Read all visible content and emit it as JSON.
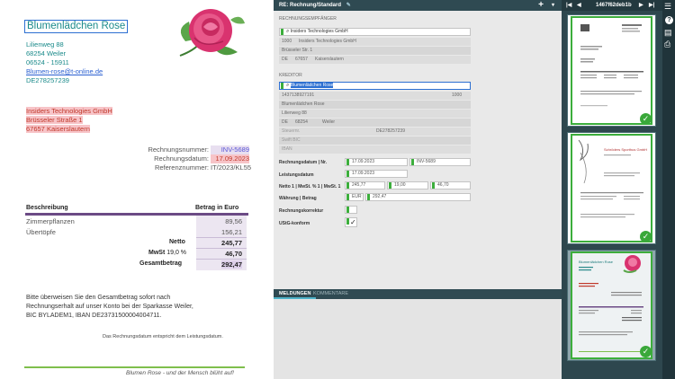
{
  "invoice": {
    "sender_name": "Blumenlädchen Rose",
    "sender_lines": [
      "Lilienweg 88",
      "68254 Weiler",
      "06524 - 15911"
    ],
    "sender_email": "Blumen-rose@t-online.de",
    "sender_vat": "DE278257239",
    "recipient_lines": [
      "Insiders Technologies GmbH",
      "Brüsseler Straße 1",
      "67657 Kaiserslautern"
    ],
    "meta": [
      {
        "label": "Rechnungsnummer:",
        "value": "INV-5689"
      },
      {
        "label": "Rechnungsdatum:",
        "value": "17.09.2023"
      },
      {
        "label": "Referenznummer:",
        "value": "IT/2023/KL55"
      }
    ],
    "table_head": {
      "desc": "Beschreibung",
      "amount": "Betrag in Euro"
    },
    "items": [
      {
        "desc": "Zimmerpflanzen",
        "amount": "89,56"
      },
      {
        "desc": "Übertöpfe",
        "amount": "156,21"
      }
    ],
    "netto_label": "Netto",
    "netto": "245,77",
    "mwst_label": "MwSt",
    "mwst_rate": "19,0 %",
    "mwst": "46,70",
    "total_label": "Gesamtbetrag",
    "total": "292,47",
    "payment_text": [
      "Bitte überweisen Sie den Gesamtbetrag sofort nach",
      "Rechnungserhalt auf unser Konto bei der Sparkasse Weiler,",
      "BIC BYLADEM1, IBAN DE23731500004004711."
    ],
    "note": "Das Rechnungsdatum entspricht dem Leistungsdatum.",
    "footer": "Blumen Rose - und der Mensch blüht auf!"
  },
  "center": {
    "title": "RE: Rechnung/Standard",
    "plus": "+",
    "sections": {
      "recipient": "RECHNUNGSEMPFÄNGER",
      "creditor": "KREDITOR"
    },
    "recipient_search": "Insiders Technologies GmbH",
    "recipient_rows": [
      [
        "1000",
        "Insiders Technologies GmbH"
      ],
      [
        "Brüsseler Str. 1"
      ],
      [
        "DE",
        "67657",
        "Kaiserslautern"
      ]
    ],
    "creditor_search": "Blumenlädchen Rose",
    "creditor_rows": [
      [
        "1437138927191",
        "",
        "1000"
      ],
      [
        "Blumenlädchen Rose"
      ],
      [
        "Lilienweg 88"
      ],
      [
        "DE",
        "68254",
        "Weiler"
      ],
      [
        "Steuernr.",
        "",
        "DE278257239"
      ],
      [
        "Swift BIC"
      ],
      [
        "IBAN"
      ]
    ],
    "form": {
      "date_label": "Rechnungsdatum | Nr.",
      "date": "17.09.2023",
      "number": "INV-5689",
      "service_label": "Leistungsdatum",
      "service": "17.09.2023",
      "netto_label": "Netto 1 | MwSt. % 1 | MwSt. 1",
      "netto": "245,77",
      "rate": "19,00",
      "mwst": "46,70",
      "currency_label": "Währung | Betrag",
      "currency": "EUR",
      "amount": "292,47",
      "correction_label": "Rechnungskorrektur",
      "ustg_label": "UStG-konform",
      "ustg_check": "✓"
    },
    "tabs": [
      "MELDUNGEN",
      "KOMMENTARE"
    ]
  },
  "thumbs": {
    "doc_id": "1467f62deb1b",
    "first": "|◀",
    "prev": "◀",
    "next": "▶",
    "last": "▶|",
    "check": "✓",
    "t2_title": "Schröders Sporthus GmbH",
    "t3_title": "Blumenlädchen Rose"
  },
  "tools": {
    "menu": "☰",
    "help": "?",
    "doc": "▤",
    "print": "⎙"
  }
}
